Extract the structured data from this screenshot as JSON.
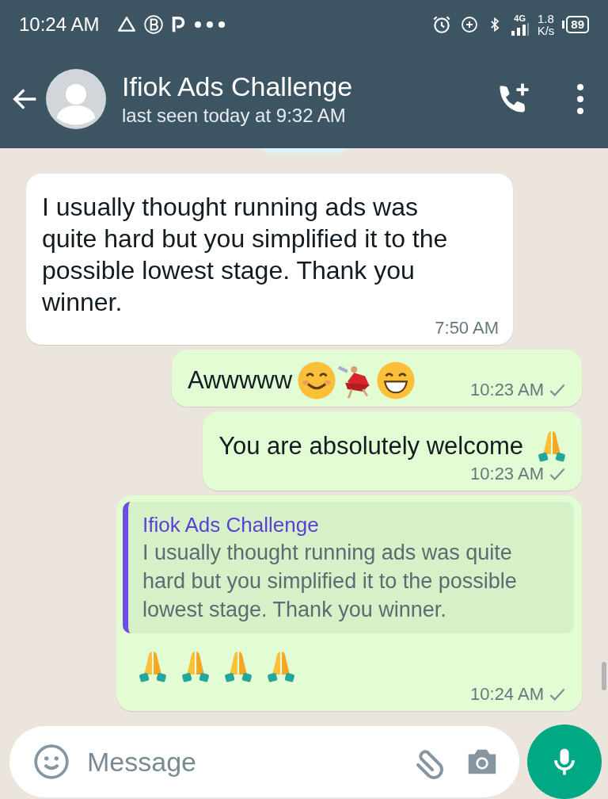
{
  "status_bar": {
    "time": "10:24 AM",
    "network": "4G",
    "speed": "1.8",
    "speed_unit": "K/s",
    "battery": "89"
  },
  "header": {
    "title": "Ifiok Ads Challenge",
    "subtitle": "last seen today at 9:32 AM"
  },
  "messages": [
    {
      "kind": "incoming",
      "text": "I usually thought running ads was quite hard but you simplified it to the possible lowest stage. Thank you winner.",
      "time": "7:50 AM"
    },
    {
      "kind": "outgoing",
      "text": "Awwwww",
      "emoji": [
        {
          "kind": "smile"
        },
        {
          "kind": "dancer"
        },
        {
          "kind": "grin"
        }
      ],
      "time": "10:23 AM",
      "read": false
    },
    {
      "kind": "outgoing",
      "text": "You are absolutely welcome",
      "emoji": [
        {
          "kind": "pray"
        }
      ],
      "time": "10:23 AM",
      "read": false
    },
    {
      "kind": "outgoing",
      "quote": {
        "author": "Ifiok Ads Challenge",
        "text": "I usually thought running ads was quite hard but you simplified it to the possible lowest stage. Thank you winner."
      },
      "emoji": [
        {
          "kind": "pray"
        },
        {
          "kind": "pray"
        },
        {
          "kind": "pray"
        },
        {
          "kind": "pray"
        }
      ],
      "time": "10:24 AM",
      "read": false
    }
  ],
  "composer": {
    "placeholder": "Message"
  }
}
